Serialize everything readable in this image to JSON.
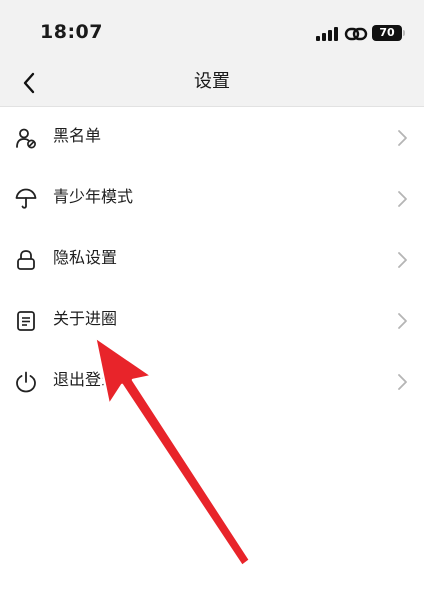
{
  "status_bar": {
    "time": "18:07",
    "battery": "70",
    "icons": [
      "signal-icon",
      "link-icon",
      "battery-icon"
    ]
  },
  "nav": {
    "title": "设置",
    "back_icon": "chevron-left-icon"
  },
  "menu": {
    "items": [
      {
        "label": "黑名单",
        "icon": "blocked-user-icon"
      },
      {
        "label": "青少年模式",
        "icon": "umbrella-icon"
      },
      {
        "label": "隐私设置",
        "icon": "lock-icon"
      },
      {
        "label": "关于进圈",
        "icon": "document-icon"
      },
      {
        "label": "退出登录",
        "icon": "power-icon"
      }
    ],
    "chevron_icon": "chevron-right-icon"
  },
  "annotation": {
    "icon": "red-arrow-icon",
    "color": "#e8242a"
  },
  "colors": {
    "header_bg": "#f2f2f2",
    "page_bg": "#ffffff",
    "text": "#1a1a1a",
    "chevron": "#b5b5b5",
    "arrow": "#e8242a"
  }
}
